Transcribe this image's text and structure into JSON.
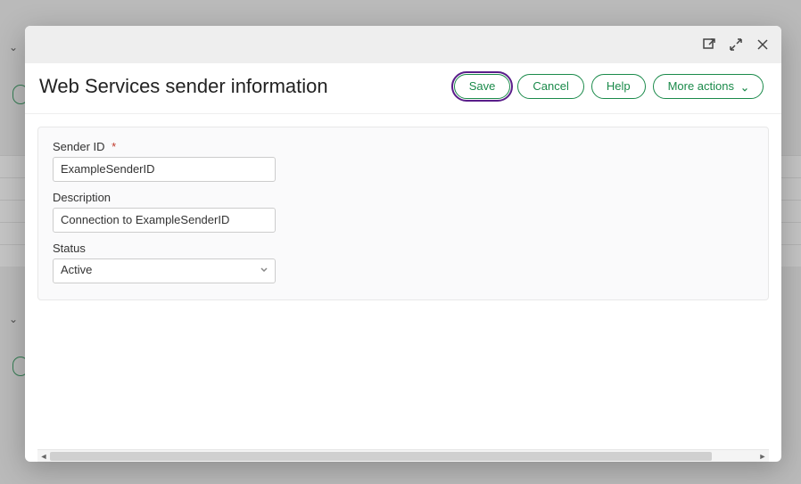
{
  "modal": {
    "title": "Web Services sender information",
    "actions": {
      "save": "Save",
      "cancel": "Cancel",
      "help": "Help",
      "more": "More actions"
    }
  },
  "form": {
    "sender_id": {
      "label": "Sender ID",
      "required_marker": "*",
      "value": "ExampleSenderID"
    },
    "description": {
      "label": "Description",
      "value": "Connection to ExampleSenderID"
    },
    "status": {
      "label": "Status",
      "value": "Active"
    }
  }
}
